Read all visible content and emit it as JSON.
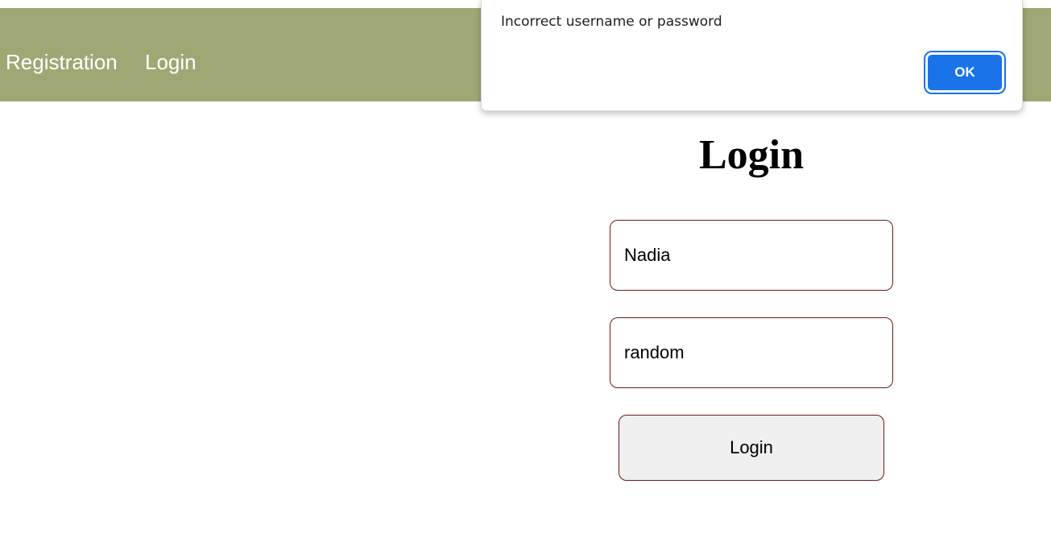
{
  "navbar": {
    "background": "#9fa874",
    "links": [
      {
        "label": "Registration"
      },
      {
        "label": "Login"
      }
    ]
  },
  "login_form": {
    "title": "Login",
    "username": {
      "value": "Nadia"
    },
    "password": {
      "value": "random"
    },
    "submit_label": "Login"
  },
  "alert": {
    "message": "Incorrect username or password",
    "ok_label": "OK",
    "accent": "#1a73e8"
  }
}
